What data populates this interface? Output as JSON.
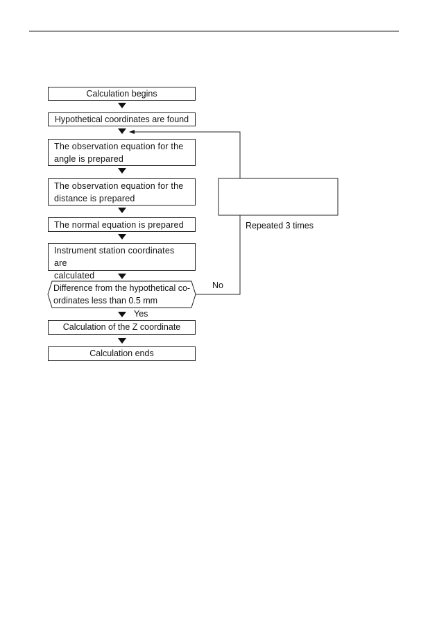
{
  "flowchart": {
    "steps": [
      "Calculation begins",
      "Hypothetical coordinates are found",
      "The observation equation for the angle is prepared",
      "The observation equation for the distance is prepared",
      "The normal equation is prepared",
      "Instrument station coordinates are calculated",
      "Difference from the hypothetical coordinates less than 0.5 mm",
      "Calculation of the Z coordinate",
      "Calculation ends"
    ],
    "lines": {
      "step3": [
        "The observation equation for the",
        "angle is prepared"
      ],
      "step4": [
        "The observation equation for the",
        "distance is prepared"
      ],
      "step6": [
        "Instrument station coordinates are",
        "calculated"
      ],
      "decision": [
        "Difference from the hypothetical co-",
        "ordinates less than 0.5 mm"
      ]
    },
    "yes_label": "Yes",
    "no_label": "No",
    "loop_label": "Repeated 3 times"
  }
}
